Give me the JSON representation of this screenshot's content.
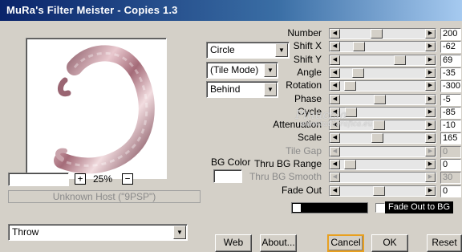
{
  "window": {
    "title": "MuRa's Filter Meister - Copies 1.3"
  },
  "preview": {
    "zoom": "25%",
    "zoom_in": "+",
    "zoom_out": "−",
    "host_status": "Unknown Host (\"9PSP\")"
  },
  "selects": {
    "shape": "Circle",
    "tile_mode": "(Tile Mode)",
    "placement": "Behind",
    "throw": "Throw"
  },
  "bg_color": {
    "label": "BG Color",
    "color": "#ffffff"
  },
  "params": [
    {
      "label": "Number",
      "value": "200",
      "pos": 0.42,
      "enabled": true
    },
    {
      "label": "Shift X",
      "value": "-62",
      "pos": 0.18,
      "enabled": true
    },
    {
      "label": "Shift Y",
      "value": "69",
      "pos": 0.74,
      "enabled": true
    },
    {
      "label": "Angle",
      "value": "-35",
      "pos": 0.17,
      "enabled": true
    },
    {
      "label": "Rotation",
      "value": "-300",
      "pos": 0.06,
      "enabled": true
    },
    {
      "label": "Phase",
      "value": "-5",
      "pos": 0.46,
      "enabled": true
    },
    {
      "label": "Cycle",
      "value": "-85",
      "pos": 0.07,
      "enabled": true
    },
    {
      "label": "Attenuation",
      "value": "-10",
      "pos": 0.45,
      "enabled": true
    },
    {
      "label": "Scale",
      "value": "165",
      "pos": 0.43,
      "enabled": true
    },
    {
      "label": "Tile Gap",
      "value": "0",
      "pos": 0.0,
      "enabled": false
    },
    {
      "label": "Thru BG Range",
      "value": "0",
      "pos": 0.06,
      "enabled": true
    },
    {
      "label": "Thru BG Smooth",
      "value": "30",
      "pos": 0.0,
      "enabled": false
    },
    {
      "label": "Fade Out",
      "value": "0",
      "pos": 0.45,
      "enabled": true
    }
  ],
  "fade": {
    "label": "Fade Out to BG",
    "checked": false
  },
  "buttons": {
    "web": "Web",
    "about": "About...",
    "cancel": "Cancel",
    "ok": "OK",
    "reset": "Reset"
  },
  "watermark": {
    "line1": "Pinuccia",
    "line2": "www.tuttigrafica.eu"
  }
}
